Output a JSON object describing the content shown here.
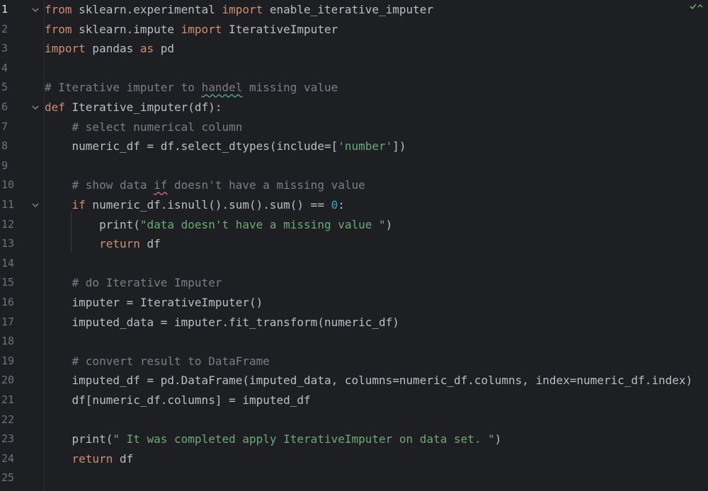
{
  "editor": {
    "lines": [
      {
        "n": "1",
        "parts": [
          [
            "kw",
            "from"
          ],
          [
            "t",
            " sklearn.experimental "
          ],
          [
            "kw",
            "import"
          ],
          [
            "t",
            " enable_iterative_imputer"
          ]
        ]
      },
      {
        "n": "2",
        "parts": [
          [
            "kw",
            "from"
          ],
          [
            "t",
            " sklearn.impute "
          ],
          [
            "kw",
            "import"
          ],
          [
            "t",
            " IterativeImputer"
          ]
        ]
      },
      {
        "n": "3",
        "parts": [
          [
            "kw",
            "import"
          ],
          [
            "t",
            " pandas "
          ],
          [
            "kw",
            "as"
          ],
          [
            "t",
            " pd"
          ]
        ]
      },
      {
        "n": "4",
        "parts": []
      },
      {
        "n": "5",
        "parts": [
          [
            "cm",
            "# Iterative imputer to "
          ],
          [
            "cmsq",
            "handel"
          ],
          [
            "cm",
            " missing value"
          ]
        ]
      },
      {
        "n": "6",
        "parts": [
          [
            "kw",
            "def"
          ],
          [
            "t",
            " Iterative_imputer(df):"
          ]
        ]
      },
      {
        "n": "7",
        "parts": [
          [
            "t",
            "    "
          ],
          [
            "cm",
            "# select numerical column"
          ]
        ]
      },
      {
        "n": "8",
        "parts": [
          [
            "t",
            "    numeric_df = df.select_dtypes(include=["
          ],
          [
            "str",
            "'number'"
          ],
          [
            "t",
            "])"
          ]
        ]
      },
      {
        "n": "9",
        "parts": []
      },
      {
        "n": "10",
        "parts": [
          [
            "t",
            "    "
          ],
          [
            "cm",
            "# show data "
          ],
          [
            "cmsqr",
            "if"
          ],
          [
            "cm",
            " doesn't have a missing value"
          ]
        ]
      },
      {
        "n": "11",
        "parts": [
          [
            "t",
            "    "
          ],
          [
            "kw",
            "if"
          ],
          [
            "t",
            " numeric_df.isnull().sum().sum() == "
          ],
          [
            "num",
            "0"
          ],
          [
            "t",
            ":"
          ]
        ]
      },
      {
        "n": "12",
        "parts": [
          [
            "t",
            "        print("
          ],
          [
            "str",
            "\"data doesn't have a missing value \""
          ],
          [
            "t",
            ")"
          ]
        ]
      },
      {
        "n": "13",
        "parts": [
          [
            "t",
            "        "
          ],
          [
            "kw",
            "return"
          ],
          [
            "t",
            " df"
          ]
        ]
      },
      {
        "n": "14",
        "parts": []
      },
      {
        "n": "15",
        "parts": [
          [
            "t",
            "    "
          ],
          [
            "cm",
            "# do Iterative Imputer"
          ]
        ]
      },
      {
        "n": "16",
        "parts": [
          [
            "t",
            "    imputer = IterativeImputer()"
          ]
        ]
      },
      {
        "n": "17",
        "parts": [
          [
            "t",
            "    imputed_data = imputer.fit_transform(numeric_df)"
          ]
        ]
      },
      {
        "n": "18",
        "parts": []
      },
      {
        "n": "19",
        "parts": [
          [
            "t",
            "    "
          ],
          [
            "cm",
            "# convert result to DataFrame"
          ]
        ]
      },
      {
        "n": "20",
        "parts": [
          [
            "t",
            "    imputed_df = pd.DataFrame(imputed_data, columns=numeric_df.columns, index=numeric_df.index)"
          ]
        ]
      },
      {
        "n": "21",
        "parts": [
          [
            "t",
            "    df[numeric_df.columns] = imputed_df"
          ]
        ]
      },
      {
        "n": "22",
        "parts": []
      },
      {
        "n": "23",
        "parts": [
          [
            "t",
            "    print("
          ],
          [
            "str",
            "\" It was completed apply IterativeImputer on data set. \""
          ],
          [
            "t",
            ")"
          ]
        ]
      },
      {
        "n": "24",
        "parts": [
          [
            "t",
            "    "
          ],
          [
            "kw",
            "return"
          ],
          [
            "t",
            " df"
          ]
        ]
      },
      {
        "n": "25",
        "parts": []
      }
    ],
    "folds": [
      "1",
      "6",
      "11"
    ],
    "active_line": "1",
    "status_icon": "check-icon"
  },
  "colors": {
    "background": "#1e1f22",
    "keyword": "#cf8e6d",
    "string": "#6aab73",
    "number": "#2aacb8",
    "comment": "#7a7e85",
    "text": "#bcbec4"
  }
}
